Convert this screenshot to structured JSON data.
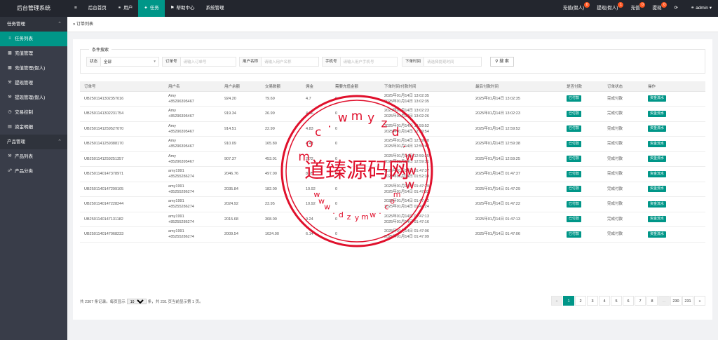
{
  "brand": "后台管理系统",
  "topnav": {
    "menu_icon": "≡",
    "items": [
      {
        "label": "后台首页",
        "icon": ""
      },
      {
        "label": "用户",
        "icon": "person-icon"
      },
      {
        "label": "任务",
        "icon": "run-icon",
        "active": true
      },
      {
        "label": "帮助中心",
        "icon": "flag-icon"
      },
      {
        "label": "系统管理",
        "icon": ""
      }
    ]
  },
  "topright": {
    "items": [
      {
        "label": "充值(假人)",
        "badge": "0"
      },
      {
        "label": "提现(假人)",
        "badge": "1"
      },
      {
        "label": "充值",
        "badge": "0"
      },
      {
        "label": "提现",
        "badge": "0"
      }
    ],
    "user": "admin"
  },
  "sidebar": {
    "groups": [
      {
        "label": "任务管理",
        "items": [
          {
            "label": "任务列表",
            "icon": "list-icon",
            "active": true
          },
          {
            "label": "充值管理",
            "icon": "chat-icon"
          },
          {
            "label": "充值管理(假人)",
            "icon": "chat-icon"
          },
          {
            "label": "提现管理",
            "icon": "wrench-icon"
          },
          {
            "label": "提现管理(假人)",
            "icon": "wrench-icon"
          },
          {
            "label": "交易控制",
            "icon": "clock-icon"
          },
          {
            "label": "资金明细",
            "icon": "doc-icon"
          }
        ]
      },
      {
        "label": "产品管理",
        "items": [
          {
            "label": "产品列表",
            "icon": "wrench-icon"
          },
          {
            "label": "产品分类",
            "icon": "link-icon"
          }
        ]
      }
    ]
  },
  "breadcrumb": "订单列表",
  "search": {
    "legend": "条件搜索",
    "status_label": "状态",
    "status_value": "全部",
    "order_label": "订单号",
    "order_ph": "请输入订单号",
    "user_label": "用户名称",
    "user_ph": "请输入用户名称",
    "phone_label": "手机号",
    "phone_ph": "请输入用户手机号",
    "time_label": "下单时间",
    "time_ph": "请选择提现时间",
    "button": "搜 索"
  },
  "table": {
    "headers": [
      "订单号",
      "用户名",
      "用户余额",
      "交易数额",
      "佣金",
      "需要充值金额",
      "下单时间/付款时间",
      "最后付款时间",
      "是否付款",
      "订单状态",
      "操作"
    ],
    "rows": [
      [
        "UB2501141302357016",
        "Amy",
        "+85296395467",
        "924.20",
        "79.69",
        "4.7",
        "0",
        "2025年01月14日 13:02:35",
        "2025年01月14日 13:02:35",
        "2025年01月14日 13:02:35",
        "已付款",
        "完成付款",
        "资金流水"
      ],
      [
        "UB2501141302231754",
        "Amy",
        "+85296395467",
        "919.34",
        "26.99",
        "4.86",
        "0",
        "2025年01月14日 13:02:23",
        "2025年01月14日 13:02:26",
        "2025年01月14日 13:02:23",
        "已付款",
        "完成付款",
        "资金流水"
      ],
      [
        "UB2501141259527070",
        "Amy",
        "+85296395467",
        "914.51",
        "22.99",
        "4.83",
        "0",
        "2025年01月14日 12:59:52",
        "2025年01月14日 12:59:54",
        "2025年01月14日 12:59:52",
        "已付款",
        "完成付款",
        "资金流水"
      ],
      [
        "UB2501141259388170",
        "Amy",
        "+85296395467",
        "910.09",
        "165.80",
        "4.42",
        "0",
        "2025年01月14日 12:59:38",
        "2025年01月14日 12:59:42",
        "2025年01月14日 12:59:38",
        "已付款",
        "完成付款",
        "资金流水"
      ],
      [
        "UB2501141259251357",
        "Amy",
        "+85296395467",
        "907.37",
        "453.01",
        "2.72",
        "0",
        "2025年01月14日 12:59:25",
        "2025年01月14日 12:59:31",
        "2025年01月14日 12:59:25",
        "已付款",
        "完成付款",
        "资金流水"
      ],
      [
        "UB2501140147378971",
        "amy1991",
        "+85255286274",
        "2046.76",
        "497.00",
        "8.95",
        "0",
        "2025年01月14日 01:47:37",
        "2025年01月14日 01:52:39",
        "2025年01月14日 01:47:37",
        "已付款",
        "完成付款",
        "资金流水"
      ],
      [
        "UB2501140147299105",
        "amy1991",
        "+85255286274",
        "2035.84",
        "182.00",
        "10.92",
        "0",
        "2025年01月14日 01:47:29",
        "2025年01月14日 01:47:32",
        "2025年01月14日 01:47:29",
        "已付款",
        "完成付款",
        "资金流水"
      ],
      [
        "UB2501140147228244",
        "amy1991",
        "+85255286274",
        "2024.92",
        "23.95",
        "10.92",
        "0",
        "2025年01月14日 01:47:22",
        "2025年01月14日 01:47:24",
        "2025年01月14日 01:47:22",
        "已付款",
        "完成付款",
        "资金流水"
      ],
      [
        "UB2501140147131182",
        "amy1991",
        "+85255286274",
        "2015.68",
        "308.00",
        "9.24",
        "0",
        "2025年01月14日 01:47:13",
        "2025年01月14日 01:47:16",
        "2025年01月14日 01:47:13",
        "已付款",
        "完成付款",
        "资金流水"
      ],
      [
        "UB2501140147068233",
        "amy1991",
        "+85255286274",
        "2009.54",
        "1024.00",
        "6.14",
        "0",
        "2025年01月14日 01:47:06",
        "2025年01月14日 01:47:09",
        "2025年01月14日 01:47:06",
        "已付款",
        "完成付款",
        "资金流水"
      ]
    ]
  },
  "pager": {
    "info_prefix": "共 2307 条记录。每页显示",
    "per_page": "10",
    "info_suffix": "条，共 231 页当前显示第 1 页。",
    "pages": [
      "«",
      "1",
      "2",
      "3",
      "4",
      "5",
      "6",
      "7",
      "8",
      "...",
      "230",
      "231",
      "»"
    ],
    "active": "1"
  },
  "watermark": {
    "center_text": "道臻源码网",
    "ring_text": "www.dzymw.com",
    "color": "#e0102c"
  }
}
